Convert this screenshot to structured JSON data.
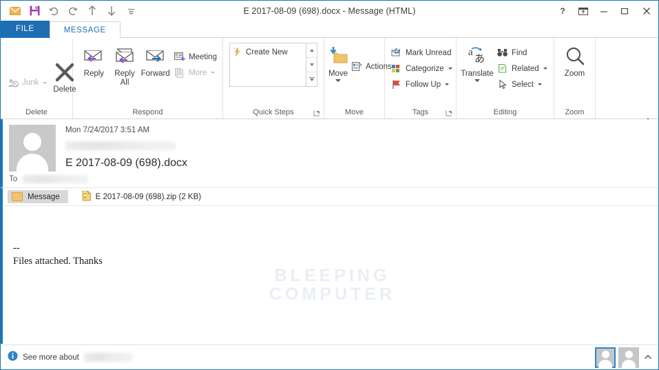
{
  "window": {
    "title": "E 2017-08-09 (698).docx - Message (HTML)",
    "quick_access": [
      {
        "name": "envelope-icon",
        "label": "Message"
      },
      {
        "name": "save-icon",
        "label": "Save"
      },
      {
        "name": "undo-icon",
        "label": "Undo"
      },
      {
        "name": "redo-icon",
        "label": "Redo"
      },
      {
        "name": "previous-item-icon",
        "label": "Previous Item"
      },
      {
        "name": "next-item-icon",
        "label": "Next Item"
      },
      {
        "name": "customize-qat-icon",
        "label": "Customize Quick Access Toolbar"
      }
    ],
    "controls": {
      "help": "?",
      "ribbon_display": "Ribbon Display Options",
      "minimize": "Minimize",
      "maximize": "Maximize",
      "close": "Close"
    }
  },
  "tabs": {
    "file": "FILE",
    "message": "MESSAGE"
  },
  "ribbon": {
    "collapse_label": "Collapse the Ribbon",
    "groups": [
      {
        "label": "Delete",
        "buttons": [
          {
            "label": "Junk",
            "icon": "junk-icon",
            "disabled": true,
            "has_caret": true
          },
          {
            "label": "Delete",
            "icon": "delete-x-icon",
            "disabled": false,
            "has_caret": false
          }
        ]
      },
      {
        "label": "Respond",
        "buttons": [
          {
            "label": "Reply",
            "icon": "reply-icon"
          },
          {
            "label": "Reply All",
            "icon": "reply-all-icon"
          },
          {
            "label": "Forward",
            "icon": "forward-icon"
          },
          {
            "label": "Meeting",
            "icon": "meeting-icon"
          },
          {
            "label": "More",
            "icon": "more-icon",
            "disabled": true,
            "has_caret": true
          }
        ]
      },
      {
        "label": "Quick Steps",
        "gallery_item": "Create New",
        "gallery_icon": "quick-step-lightning-icon",
        "has_launcher": true
      },
      {
        "label": "Move",
        "buttons": [
          {
            "label": "Move",
            "icon": "move-folder-icon",
            "has_caret": true
          },
          {
            "label": "Actions",
            "icon": "actions-icon",
            "has_caret": true
          }
        ]
      },
      {
        "label": "Tags",
        "has_launcher": true,
        "buttons": [
          {
            "label": "Mark Unread",
            "icon": "mark-unread-icon"
          },
          {
            "label": "Categorize",
            "icon": "categorize-icon",
            "has_caret": true
          },
          {
            "label": "Follow Up",
            "icon": "follow-up-flag-icon",
            "has_caret": true
          }
        ]
      },
      {
        "label": "Editing",
        "buttons": [
          {
            "label": "Translate",
            "icon": "translate-icon",
            "has_caret": true
          },
          {
            "label": "Find",
            "icon": "find-binoculars-icon"
          },
          {
            "label": "Related",
            "icon": "related-icon",
            "has_caret": true
          },
          {
            "label": "Select",
            "icon": "select-cursor-icon",
            "has_caret": true
          }
        ]
      },
      {
        "label": "Zoom",
        "buttons": [
          {
            "label": "Zoom",
            "icon": "zoom-magnifier-icon"
          }
        ]
      }
    ]
  },
  "message": {
    "date": "Mon 7/24/2017 3:51 AM",
    "sender_redacted": true,
    "subject": "E 2017-08-09 (698).docx",
    "to_label": "To",
    "to_redacted": true,
    "attachment_tab": "Message",
    "attachment": "E 2017-08-09 (698).zip (2 KB)",
    "body_lines": [
      "--",
      "Files attached. Thanks"
    ],
    "watermark_line1": "BLEEPING",
    "watermark_line2": "COMPUTER"
  },
  "statusbar": {
    "info_icon": "info-icon",
    "see_more_label": "See more about",
    "contact_redacted": true,
    "people_pane_expand": "Expand People Pane"
  },
  "colors": {
    "accent_blue": "#1976b8",
    "file_tab_blue": "#1e6eb4",
    "selection_blue": "#2e84c8",
    "watermark": "#e9eef5",
    "folder_yellow": "#f0c36d"
  }
}
